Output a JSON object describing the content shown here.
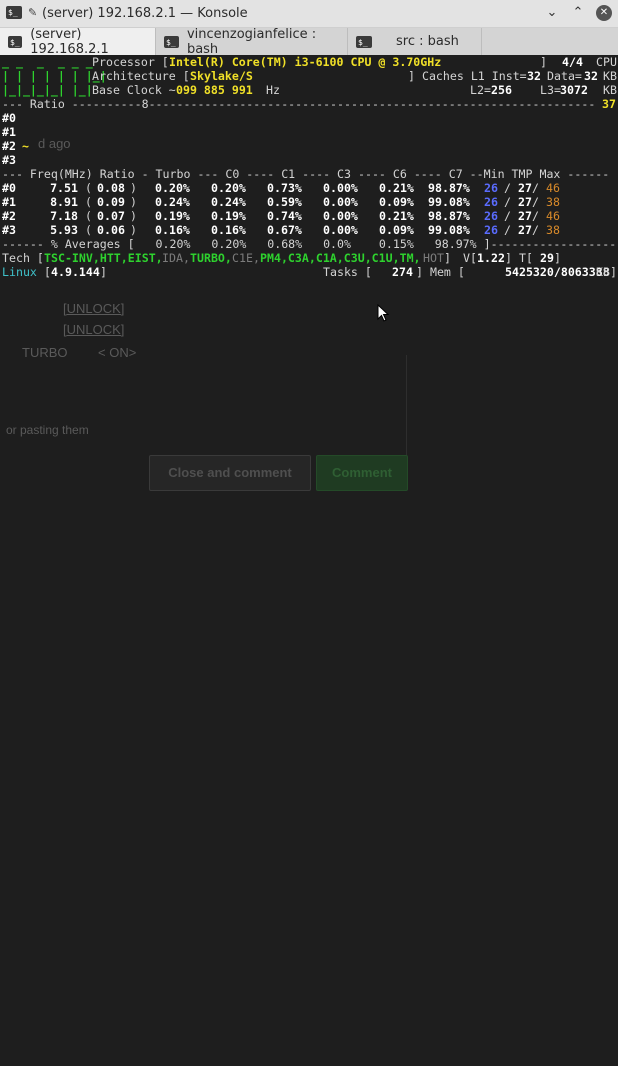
{
  "window": {
    "title": "(server) 192.168.2.1 — Konsole",
    "pin_icon": "pin-icon",
    "buttons": [
      "chevron-down-icon",
      "chevron-up-icon",
      "close-icon"
    ]
  },
  "tabs": [
    {
      "label": "(server) 192.168.2.1",
      "active": true
    },
    {
      "label": "vincenzogianfelice : bash",
      "active": false
    },
    {
      "label": "src : bash",
      "active": false
    }
  ],
  "terminal": {
    "logo": [
      "_ _  _  _ _ _",
      "| | | | | | |_|",
      "|_|_|_|_| |_|"
    ],
    "processor_label": "Processor [",
    "processor_value": "Intel(R) Core(TM) i3-6100 CPU @ 3.70GHz",
    "cpu_count": "4/4",
    "cpu_label": "CPU",
    "arch_label": "Architecture [",
    "arch_value": "Skylake/S",
    "caches_label": "] Caches L1 Inst=",
    "l1_inst": "32",
    "data_label": "Data=",
    "l1_data": "32",
    "kb": "KB",
    "base_clock_label": "Base Clock ~",
    "base_clock_value": "099 885 991",
    "hz": "Hz",
    "l2_label": "L2=",
    "l2": "256",
    "l3_label": "L3=",
    "l3": "3072",
    "ratio_line": "--- Ratio ----------8----------------------------------------------------------------",
    "ratio_right": "37",
    "core_ids": [
      "#0",
      "#1",
      "#2",
      "#3"
    ],
    "core2_tilde": "~",
    "table_header": "--- Freq(MHz) Ratio - Turbo --- C0 ---- C1 ---- C3 ---- C6 ---- C7 --Min TMP Max ------",
    "rows": [
      {
        "id": "#0",
        "freq": "7.51",
        "ratio": "0.08",
        "turbo": "0.20%",
        "c0": "0.20%",
        "c1": "0.73%",
        "c3": "0.00%",
        "c6": "0.21%",
        "c7": "98.87%",
        "min": "26",
        "tmp": "27",
        "max": "46"
      },
      {
        "id": "#1",
        "freq": "8.91",
        "ratio": "0.09",
        "turbo": "0.24%",
        "c0": "0.24%",
        "c1": "0.59%",
        "c3": "0.00%",
        "c6": "0.09%",
        "c7": "99.08%",
        "min": "26",
        "tmp": "27",
        "max": "38"
      },
      {
        "id": "#2",
        "freq": "7.18",
        "ratio": "0.07",
        "turbo": "0.19%",
        "c0": "0.19%",
        "c1": "0.74%",
        "c3": "0.00%",
        "c6": "0.21%",
        "c7": "98.87%",
        "min": "26",
        "tmp": "27",
        "max": "46"
      },
      {
        "id": "#3",
        "freq": "5.93",
        "ratio": "0.06",
        "turbo": "0.16%",
        "c0": "0.16%",
        "c1": "0.67%",
        "c3": "0.00%",
        "c6": "0.09%",
        "c7": "99.08%",
        "min": "26",
        "tmp": "27",
        "max": "38"
      }
    ],
    "averages": "------ % Averages [   0.20%   0.20%   0.68%   0.0%    0.15%   98.97% ]-------------------",
    "tech_label": "Tech [",
    "tech_on": "TSC-INV,HTT,EIST,",
    "tech_ida": "IDA,",
    "tech_on2": "TURBO,",
    "tech_c1e": "C1E,",
    "tech_on3": "PM4,C3A,C1A,C3U,C1U,TM,",
    "tech_hot": "HOT",
    "tech_close": "]",
    "voltage_label": "V[",
    "voltage": "1.22",
    "temp_label": "] T[",
    "temp": "29",
    "temp_close": "]",
    "os": "Linux",
    "kernel": "4.9.144",
    "tasks_label": "Tasks [",
    "tasks": "274",
    "mem_label": "] Mem [",
    "mem": "5425320/8063388",
    "mem_unit": "KB]"
  },
  "background_page": {
    "ago": "d ago",
    "unlock1": "[UNLOCK]",
    "unlock2": "[UNLOCK]",
    "turbo": "TURBO",
    "on": "< ON>",
    "paste": "or pasting them",
    "close_comment": "Close and comment",
    "comment": "Comment"
  }
}
